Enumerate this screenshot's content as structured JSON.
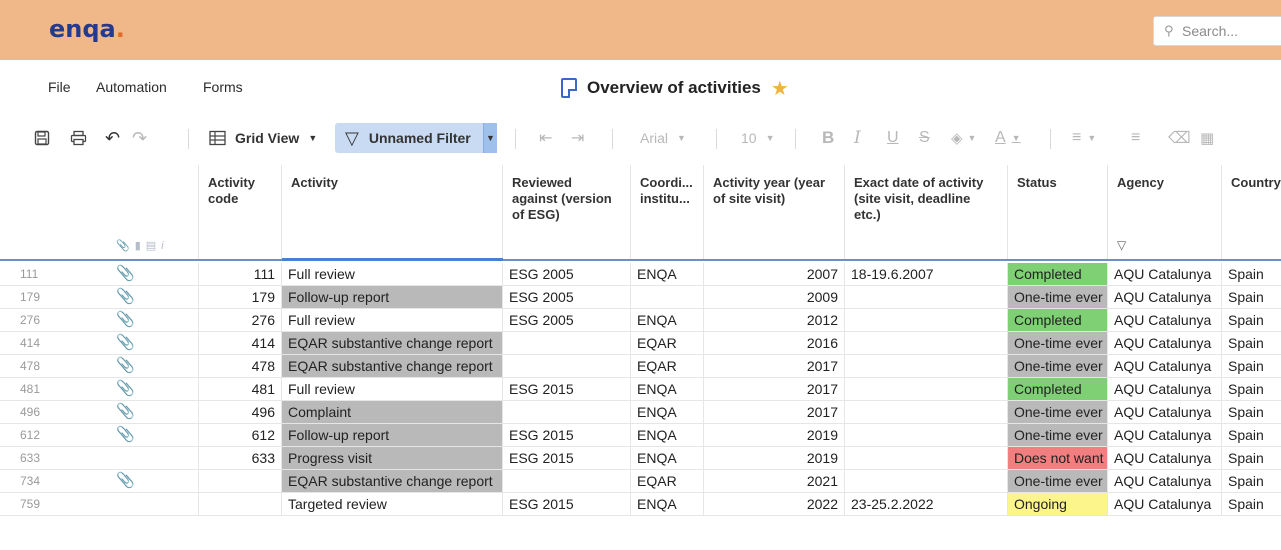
{
  "header": {
    "logo_main": "enqa",
    "logo_dot": ".",
    "search_placeholder": "Search..."
  },
  "menu": {
    "file": "File",
    "automation": "Automation",
    "forms": "Forms",
    "doc_title": "Overview of activities"
  },
  "toolbar": {
    "view": "Grid View",
    "filter": "Unnamed Filter",
    "font": "Arial",
    "font_size": "10"
  },
  "columns": {
    "code": "Activity code",
    "activity": "Activity",
    "reviewed": "Reviewed against (version of ESG)",
    "coord": "Coordi... institu...",
    "year": "Activity year (year of site visit)",
    "date": "Exact date of activity (site visit, deadline etc.)",
    "status": "Status",
    "agency": "Agency",
    "country": "Country"
  },
  "rows": [
    {
      "id": "111",
      "clip": true,
      "code": "111",
      "activity": "Full review",
      "gray": false,
      "esg": "ESG 2005",
      "coord": "ENQA",
      "year": "2007",
      "date": "18-19.6.2007",
      "status": "Completed",
      "st": "completed",
      "agency": "AQU Catalunya",
      "country": "Spain"
    },
    {
      "id": "179",
      "clip": true,
      "code": "179",
      "activity": "Follow-up report",
      "gray": true,
      "esg": "ESG 2005",
      "coord": "",
      "year": "2009",
      "date": "",
      "status": "One-time ever",
      "st": "onetime",
      "agency": "AQU Catalunya",
      "country": "Spain"
    },
    {
      "id": "276",
      "clip": true,
      "code": "276",
      "activity": "Full review",
      "gray": false,
      "esg": "ESG 2005",
      "coord": "ENQA",
      "year": "2012",
      "date": "",
      "status": "Completed",
      "st": "completed",
      "agency": "AQU Catalunya",
      "country": "Spain"
    },
    {
      "id": "414",
      "clip": true,
      "code": "414",
      "activity": "EQAR substantive change report",
      "gray": true,
      "esg": "",
      "coord": "EQAR",
      "year": "2016",
      "date": "",
      "status": "One-time ever",
      "st": "onetime",
      "agency": "AQU Catalunya",
      "country": "Spain"
    },
    {
      "id": "478",
      "clip": true,
      "code": "478",
      "activity": "EQAR substantive change report",
      "gray": true,
      "esg": "",
      "coord": "EQAR",
      "year": "2017",
      "date": "",
      "status": "One-time ever",
      "st": "onetime",
      "agency": "AQU Catalunya",
      "country": "Spain"
    },
    {
      "id": "481",
      "clip": true,
      "code": "481",
      "activity": "Full review",
      "gray": false,
      "esg": "ESG 2015",
      "coord": "ENQA",
      "year": "2017",
      "date": "",
      "status": "Completed",
      "st": "completed",
      "agency": "AQU Catalunya",
      "country": "Spain"
    },
    {
      "id": "496",
      "clip": true,
      "code": "496",
      "activity": "Complaint",
      "gray": true,
      "esg": "",
      "coord": "ENQA",
      "year": "2017",
      "date": "",
      "status": "One-time ever",
      "st": "onetime",
      "agency": "AQU Catalunya",
      "country": "Spain"
    },
    {
      "id": "612",
      "clip": true,
      "code": "612",
      "activity": "Follow-up report",
      "gray": true,
      "esg": "ESG 2015",
      "coord": "ENQA",
      "year": "2019",
      "date": "",
      "status": "One-time ever",
      "st": "onetime",
      "agency": "AQU Catalunya",
      "country": "Spain"
    },
    {
      "id": "633",
      "clip": false,
      "code": "633",
      "activity": "Progress visit",
      "gray": true,
      "esg": "ESG 2015",
      "coord": "ENQA",
      "year": "2019",
      "date": "",
      "status": "Does not want",
      "st": "notwant",
      "agency": "AQU Catalunya",
      "country": "Spain"
    },
    {
      "id": "734",
      "clip": true,
      "code": "",
      "activity": "EQAR substantive change report",
      "gray": true,
      "esg": "",
      "coord": "EQAR",
      "year": "2021",
      "date": "",
      "status": "One-time ever",
      "st": "onetime",
      "agency": "AQU Catalunya",
      "country": "Spain"
    },
    {
      "id": "759",
      "clip": false,
      "code": "",
      "activity": "Targeted review",
      "gray": false,
      "esg": "ESG 2015",
      "coord": "ENQA",
      "year": "2022",
      "date": "23-25.2.2022",
      "status": "Ongoing",
      "st": "ongoing",
      "agency": "AQU Catalunya",
      "country": "Spain"
    }
  ]
}
